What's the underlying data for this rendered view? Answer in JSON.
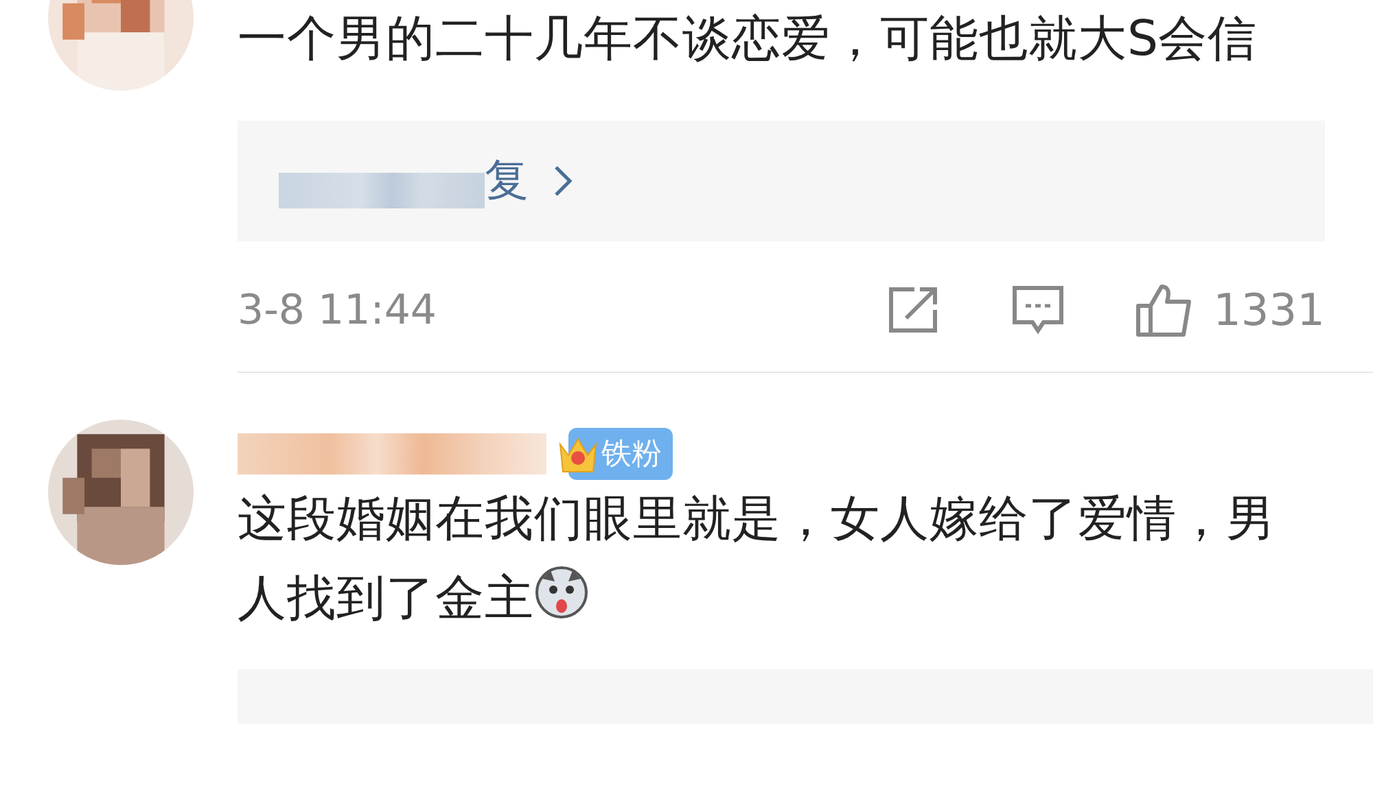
{
  "comments": [
    {
      "text": "一个男的二十几年不谈恋爱，可能也就大S会信",
      "replies_link": {
        "text": "复"
      },
      "time": "3-8 11:44",
      "likes": "1331"
    },
    {
      "badge": {
        "label": "铁粉"
      },
      "text": "这段婚姻在我们眼里就是，女人嫁给了爱情，男人找到了金主"
    }
  ]
}
